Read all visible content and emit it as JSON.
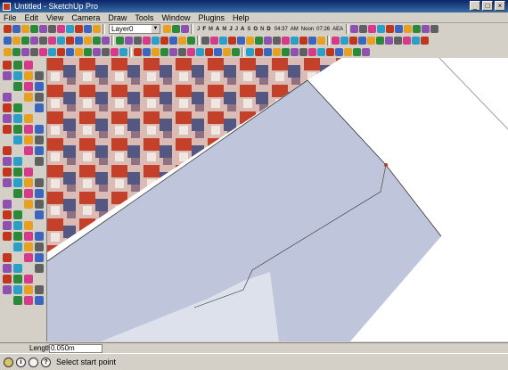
{
  "window": {
    "title": "Untitled - SketchUp Pro",
    "buttons": [
      "_",
      "□",
      "×"
    ]
  },
  "menu": [
    "File",
    "Edit",
    "View",
    "Camera",
    "Draw",
    "Tools",
    "Window",
    "Plugins",
    "Help"
  ],
  "toolbar": {
    "layer_current": "Layer0",
    "months": [
      "J",
      "F",
      "M",
      "A",
      "M",
      "J",
      "J",
      "A",
      "S",
      "O",
      "N",
      "D"
    ],
    "time_left": "04:37",
    "am_label": "AM",
    "noon_label": "Noon",
    "time_right": "07:26",
    "pm_label": "AEA"
  },
  "measurements": {
    "label": "Length",
    "value": "0.050m"
  },
  "status": {
    "text": "Select start point",
    "help_glyph": "?",
    "info_glyph": "i"
  },
  "colors": {
    "face": "#bfc6dc",
    "accent": "#c2361e",
    "texture_dark": "#4a4e7a"
  },
  "icon_palette": [
    "#c2361e",
    "#3a66c0",
    "#e8a020",
    "#2a8a3a",
    "#9050b0",
    "#606060",
    "#d83a8a",
    "#2aa0c8"
  ]
}
